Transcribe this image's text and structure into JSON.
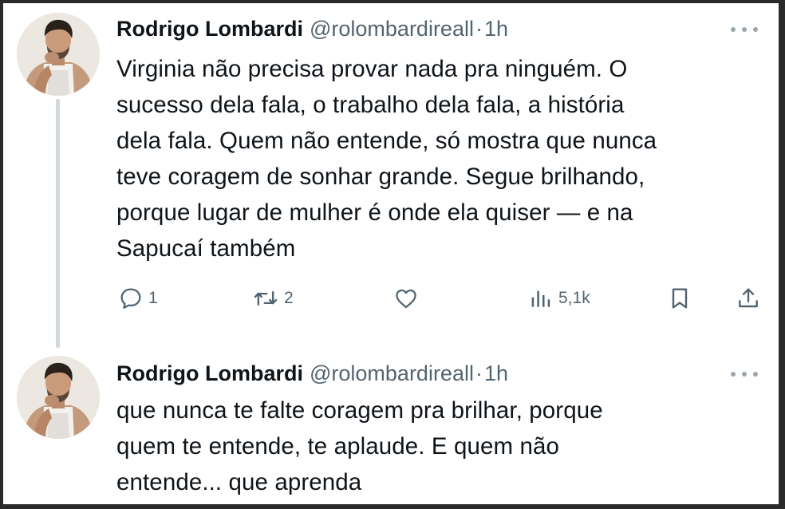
{
  "tweets": [
    {
      "author_name": "Rodrigo Lombardi",
      "handle": "@rolombardireall",
      "separator": "·",
      "time": "1h",
      "lines": [
        "Virginia não precisa provar nada pra ninguém. O",
        "sucesso dela fala, o trabalho dela fala, a história",
        "dela fala. Quem não entende, só mostra que nunca",
        "teve coragem de sonhar grande. Segue brilhando,",
        "porque lugar de mulher é onde ela quiser — e na",
        "Sapucaí também"
      ],
      "actions": {
        "reply_count": "1",
        "retweet_count": "2",
        "views_count": "5,1k"
      }
    },
    {
      "author_name": "Rodrigo Lombardi",
      "handle": "@rolombardireall",
      "separator": "·",
      "time": "1h",
      "lines": [
        "que nunca te falte coragem pra brilhar, porque",
        "quem te entende, te aplaude. E quem não",
        "entende... que aprenda"
      ]
    }
  ],
  "colors": {
    "text": "#0f1419",
    "secondary": "#536471",
    "thread_line": "#cfd9de"
  },
  "icons": {
    "reply": "speech-bubble",
    "retweet": "loop-arrows",
    "like": "heart-outline",
    "views": "bar-chart",
    "bookmark": "bookmark-outline",
    "share": "upload-arrow",
    "more": "three-dots"
  }
}
